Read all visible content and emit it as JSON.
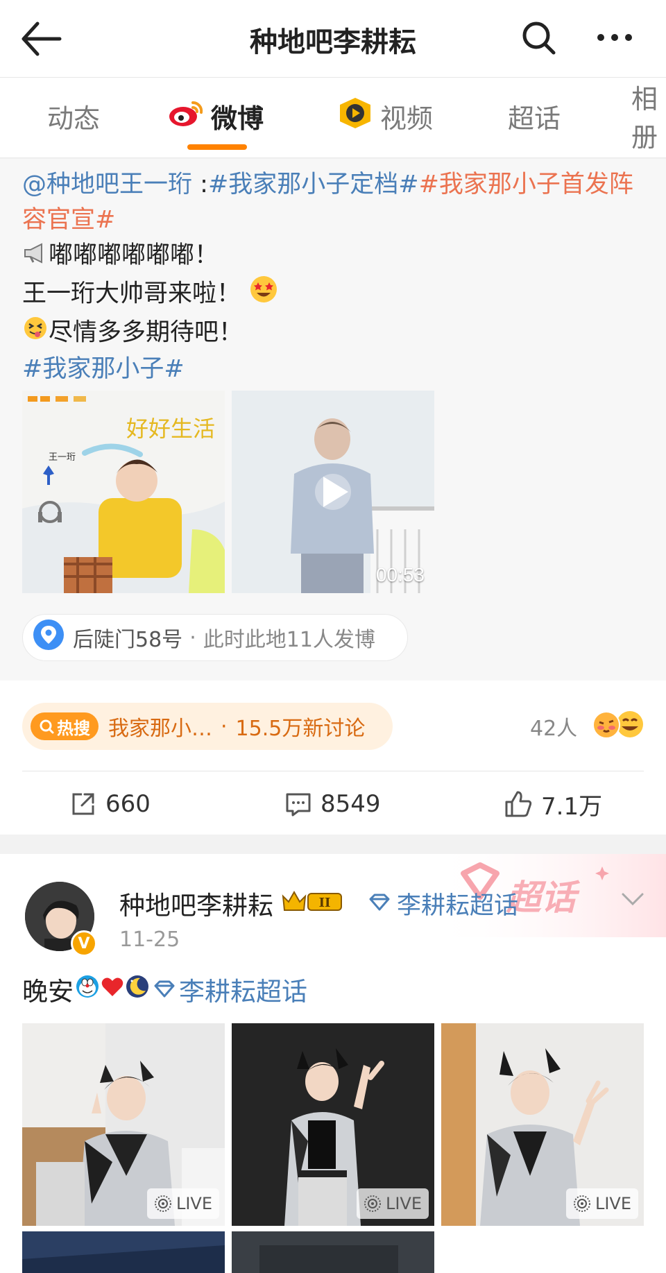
{
  "header": {
    "title": "种地吧李耕耘"
  },
  "tabs": [
    {
      "label": "动态"
    },
    {
      "label": "微博"
    },
    {
      "label": "视频"
    },
    {
      "label": "超话"
    },
    {
      "label": "相册"
    }
  ],
  "post1": {
    "mention": "@种地吧王一珩",
    "colon": " :",
    "tag1": "#我家那小子定档#",
    "tag2": "#我家那小子首发阵容官宣#",
    "line1": "嘟嘟嘟嘟嘟嘟！",
    "line2": "王一珩大帅哥来啦！",
    "line3": "尽情多多期待吧！",
    "tag3": "#我家那小子#",
    "poster_name": "王一珩",
    "poster_title": "好好生活",
    "video_duration": "00:53",
    "location": "后陡门58号",
    "location_sep": "·",
    "location_info": "此时此地11人发博"
  },
  "stats": {
    "hot_badge": "热搜",
    "hot_text": "我家那小…",
    "hot_sep": "·",
    "hot_count": "15.5万新讨论",
    "likers": "42人",
    "repost": "660",
    "comment": "8549",
    "like": "7.1万"
  },
  "post2": {
    "username": "种地吧李耕耘",
    "level_badge": "II",
    "supertopic": "李耕耘超话",
    "bg_label": "超话",
    "date": "11-25",
    "text": "晚安",
    "text_topic": "李耕耘超话",
    "verified_mark": "V",
    "live_label": "LIVE"
  },
  "colors": {
    "accent": "#ff8200",
    "link": "#4a7fb8",
    "topic_orange": "#eb7350"
  }
}
